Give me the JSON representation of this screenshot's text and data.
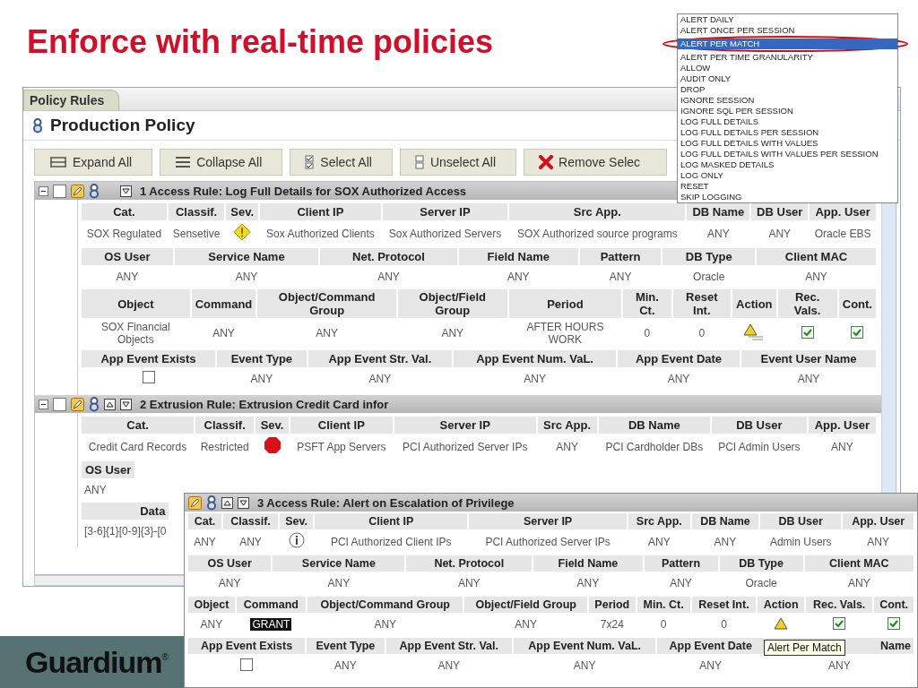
{
  "slide_title": "Enforce with real-time policies",
  "tab": {
    "label": "Policy Rules",
    "selected": true
  },
  "policy_title": "Production Policy",
  "toolbar": [
    {
      "kind": "expand",
      "label": "Expand All"
    },
    {
      "kind": "collapse",
      "label": "Collapse All"
    },
    {
      "kind": "select",
      "label": "Select All"
    },
    {
      "kind": "unselect",
      "label": "Unselect All"
    },
    {
      "kind": "remove",
      "label": "Remove Selec"
    }
  ],
  "rules": [
    {
      "title": "1 Access Rule: Log Full Details for SOX Authorized Access",
      "expanded": true,
      "checked": false,
      "move_up": false,
      "move_down": true,
      "sections": [
        {
          "columns": [
            "Cat.",
            "Classif.",
            "Sev.",
            "Client IP",
            "Server IP",
            "Src App.",
            "DB Name",
            "DB User",
            "App. User"
          ],
          "cells": [
            "SOX Regulated",
            "Sensetive",
            {
              "kind": "warning"
            },
            "Sox Authorized Clients",
            "Sox Authorized Servers",
            "SOX Authorized source programs",
            "ANY",
            "ANY",
            "Oracle EBS"
          ]
        },
        {
          "columns": [
            "OS User",
            "Service Name",
            "Net. Protocol",
            "Field Name",
            "Pattern",
            "DB Type",
            "Client MAC"
          ],
          "cells": [
            "ANY",
            "ANY",
            "ANY",
            "ANY",
            "ANY",
            "Oracle",
            "ANY"
          ]
        },
        {
          "columns": [
            "Object",
            "Command",
            "Object/Command Group",
            "Object/Field Group",
            "Period",
            "Min. Ct.",
            "Reset Int.",
            "Action",
            "Rec. Vals.",
            "Cont."
          ],
          "cells": [
            "SOX Financial Objects",
            "ANY",
            "ANY",
            "ANY",
            "AFTER HOURS WORK",
            "0",
            "0",
            {
              "kind": "alert-log"
            },
            {
              "kind": "checkbox",
              "checked": true
            },
            {
              "kind": "checkbox",
              "checked": true
            }
          ]
        },
        {
          "columns": [
            "App Event Exists",
            "Event Type",
            "App Event Str. Val.",
            "App Event Num. VaL.",
            "App Event Date",
            "Event User Name"
          ],
          "cells": [
            {
              "kind": "checkbox",
              "checked": false
            },
            "ANY",
            "ANY",
            "ANY",
            "ANY",
            "ANY"
          ]
        }
      ]
    },
    {
      "title": "2 Extrusion Rule: Extrusion Credit Card infor",
      "expanded": true,
      "checked": false,
      "move_up": true,
      "move_down": true,
      "sections": [
        {
          "columns": [
            "Cat.",
            "Classif.",
            "Sev.",
            "Client IP",
            "Server IP",
            "Src App.",
            "DB Name",
            "DB User",
            "App. User"
          ],
          "cells": [
            "Credit Card Records",
            "Restricted",
            {
              "kind": "stop"
            },
            "PSFT App Servers",
            "PCI Authorized Server IPs",
            "ANY",
            "PCI Cardholder DBs",
            "PCI Admin Users",
            "ANY"
          ]
        },
        {
          "partial": true,
          "columns": [
            "OS User"
          ],
          "cells": [
            "ANY"
          ]
        },
        {
          "partial": true,
          "columns": [
            "Data"
          ],
          "cells": [
            "[3-6]{1}[0-9]{3}-[0"
          ]
        }
      ]
    }
  ],
  "dropdown": {
    "items": [
      {
        "label": "ALERT DAILY",
        "selected": false
      },
      {
        "label": "ALERT ONCE PER SESSION",
        "selected": false
      },
      {
        "label": "ALERT PER MATCH",
        "selected": true
      },
      {
        "label": "ALERT PER TIME GRANULARITY",
        "selected": false
      },
      {
        "label": "ALLOW",
        "selected": false
      },
      {
        "label": "AUDIT ONLY",
        "selected": false
      },
      {
        "label": "DROP",
        "selected": false
      },
      {
        "label": "IGNORE SESSION",
        "selected": false
      },
      {
        "label": "IGNORE SQL PER SESSION",
        "selected": false
      },
      {
        "label": "LOG FULL DETAILS",
        "selected": false
      },
      {
        "label": "LOG FULL DETAILS PER SESSION",
        "selected": false
      },
      {
        "label": "LOG FULL DETAILS WITH VALUES",
        "selected": false
      },
      {
        "label": "LOG FULL DETAILS WITH VALUES PER SESSION",
        "selected": false
      },
      {
        "label": "LOG MASKED DETAILS",
        "selected": false
      },
      {
        "label": "LOG ONLY",
        "selected": false
      },
      {
        "label": "RESET",
        "selected": false
      },
      {
        "label": "SKIP LOGGING",
        "selected": false
      }
    ]
  },
  "popup_rule": {
    "title": "3 Access Rule: Alert on Escalation of Privilege",
    "move_up": true,
    "move_down": true,
    "tooltip": "Alert Per Match",
    "sections": [
      {
        "columns": [
          "Cat.",
          "Classif.",
          "Sev.",
          "Client IP",
          "Server IP",
          "Src App.",
          "DB Name",
          "DB User",
          "App. User"
        ],
        "cells": [
          "ANY",
          "ANY",
          {
            "kind": "info"
          },
          "PCI Authorized Client IPs",
          "PCI Authorized Server IPs",
          "ANY",
          "ANY",
          "Admin Users",
          "ANY"
        ]
      },
      {
        "columns": [
          "OS User",
          "Service Name",
          "Net. Protocol",
          "Field Name",
          "Pattern",
          "DB Type",
          "Client MAC"
        ],
        "cells": [
          "ANY",
          "ANY",
          "ANY",
          "ANY",
          "ANY",
          "Oracle",
          "ANY"
        ]
      },
      {
        "columns": [
          "Object",
          "Command",
          "Object/Command Group",
          "Object/Field Group",
          "Period",
          "Min. Ct.",
          "Reset Int.",
          "Action",
          "Rec. Vals.",
          "Cont."
        ],
        "cells": [
          "ANY",
          {
            "kind": "highlight",
            "text": "GRANT"
          },
          "ANY",
          "ANY",
          "7x24",
          "0",
          "0",
          {
            "kind": "alert"
          },
          {
            "kind": "checkbox",
            "checked": true
          },
          {
            "kind": "checkbox",
            "checked": true
          }
        ]
      },
      {
        "columns": [
          "App Event Exists",
          "Event Type",
          "App Event Str. Val.",
          "App Event Num. VaL.",
          "App Event Date",
          "Name"
        ],
        "cells": [
          {
            "kind": "checkbox",
            "checked": false
          },
          "ANY",
          "ANY",
          "ANY",
          "ANY",
          "ANY"
        ]
      }
    ]
  },
  "logo": {
    "text": "Guardium",
    "mark": "®"
  }
}
